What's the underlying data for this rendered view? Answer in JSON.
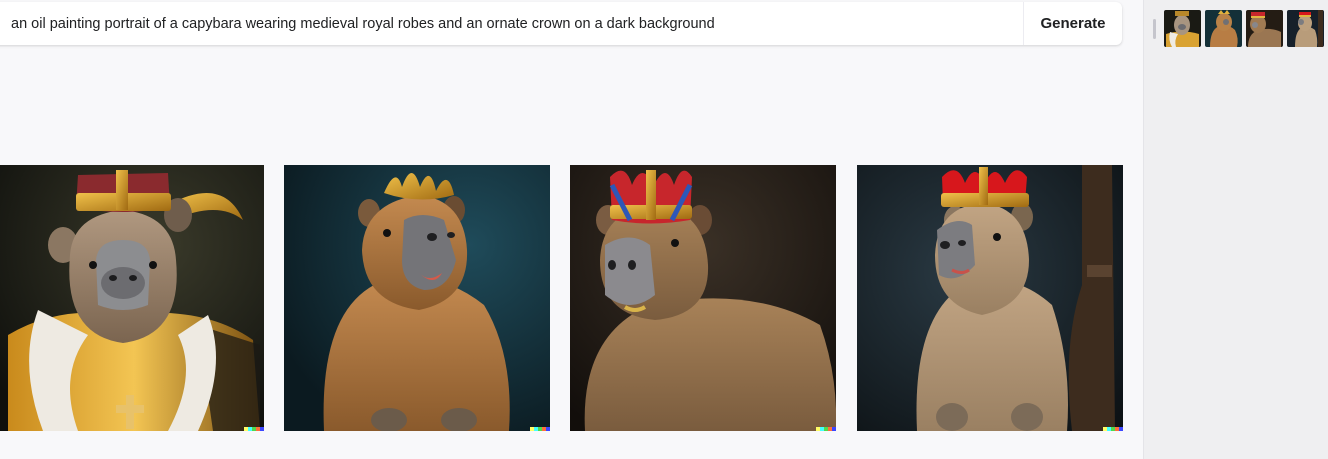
{
  "prompt": {
    "value": "an oil painting portrait of a capybara wearing medieval royal robes and an ornate crown on a dark background"
  },
  "generate_button": {
    "label": "Generate"
  },
  "results": [
    {
      "name": "capybara-portrait-1"
    },
    {
      "name": "capybara-portrait-2"
    },
    {
      "name": "capybara-portrait-3"
    },
    {
      "name": "capybara-portrait-4"
    }
  ],
  "history_thumbnails": [
    {
      "name": "history-thumb-1"
    },
    {
      "name": "history-thumb-2"
    },
    {
      "name": "history-thumb-3"
    },
    {
      "name": "history-thumb-4"
    }
  ],
  "colors": {
    "background": "#f8f8fa",
    "sidebar": "#efeff1",
    "text": "#202123",
    "dalle_signature": [
      "#ffff66",
      "#42ffff",
      "#51da4c",
      "#ff6e3c",
      "#3c46ff"
    ]
  }
}
